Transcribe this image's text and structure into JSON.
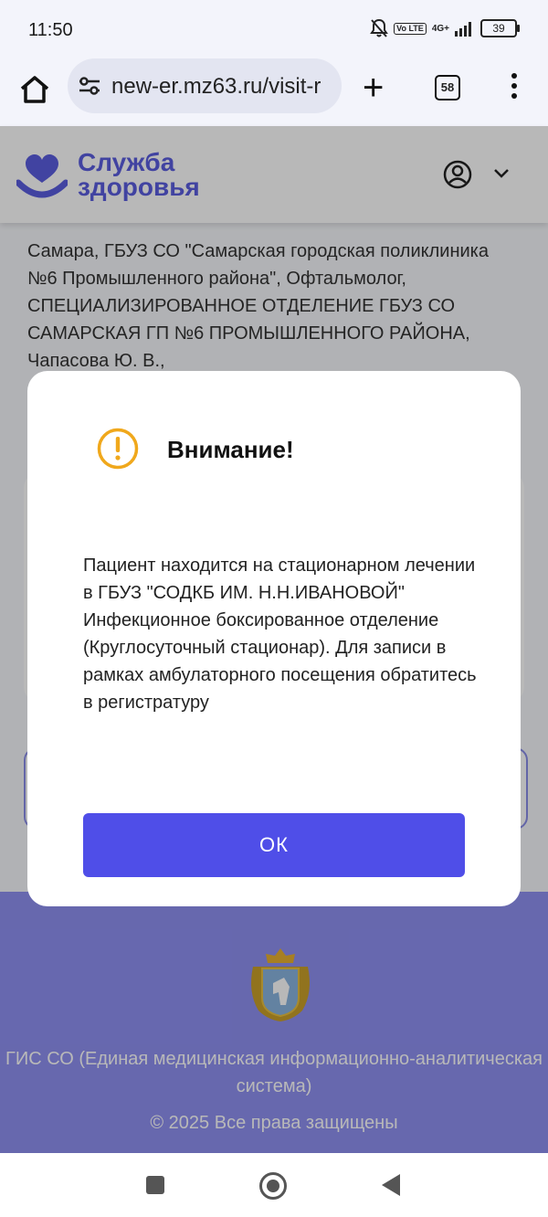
{
  "status_bar": {
    "time": "11:50",
    "network": "4G+",
    "volte": "Vo LTE",
    "battery": "39",
    "icons": [
      "bell-off-icon",
      "volte-icon",
      "signal-icon",
      "battery-icon"
    ]
  },
  "browser": {
    "url": "new-er.mz63.ru/visit-r",
    "tab_count": "58",
    "icons": [
      "home-icon",
      "tune-icon",
      "plus-icon",
      "tabs-icon",
      "more-vert-icon"
    ]
  },
  "site": {
    "logo_line1": "Служба",
    "logo_line2": "здоровья",
    "brand_color": "#5b5ee0",
    "info_text": "Самара, ГБУЗ СО \"Самарская городская поликлиника №6 Промышленного района\", Офтальмолог, СПЕЦИАЛИЗИРОВАННОЕ ОТДЕЛЕНИЕ ГБУЗ СО САМАРСКАЯ ГП №6 ПРОМЫШЛЕННОГО РАЙОНА, Чапасова Ю. В.,"
  },
  "modal": {
    "title": "Внимание!",
    "body": "Пациент находится на стационарном лечении в ГБУЗ \"СОДКБ ИМ. Н.Н.ИВАНОВОЙ\" Инфекционное боксированное отделение (Круглосуточный стационар). Для записи в рамках амбулаторного посещения обратитесь в регистратуру",
    "ok_label": "ОК",
    "warning_color": "#f0a81c",
    "button_color": "#4f4ee8"
  },
  "footer": {
    "system_name": "ГИС СО (Единая медицинская информационно-аналитическая система)",
    "copyright": "© 2025 Все права защищены",
    "background": "#8f90f2"
  }
}
